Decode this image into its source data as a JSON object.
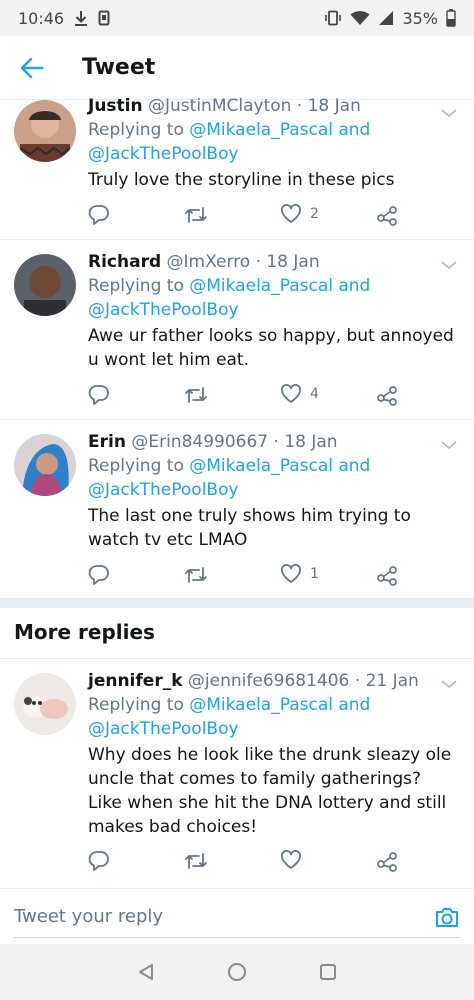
{
  "status_bar": {
    "time": "10:46",
    "battery": "35%"
  },
  "header": {
    "title": "Tweet"
  },
  "tweets": [
    {
      "name": "Justin",
      "handle": "@JustinMClayton",
      "date": "· 18 Jan",
      "replying_prefix": "Replying to",
      "replying_to_1": "@Mikaela_Pascal",
      "replying_and": "and",
      "replying_to_2": "@JackThePoolBoy",
      "text": "Truly love the storyline in these pics",
      "likes": "2"
    },
    {
      "name": "Richard",
      "handle": "@ImXerro",
      "date": "· 18 Jan",
      "replying_prefix": "Replying to",
      "replying_to_1": "@Mikaela_Pascal",
      "replying_and": "and",
      "replying_to_2": "@JackThePoolBoy",
      "text": "Awe ur father looks so happy, but annoyed u wont let him eat.",
      "likes": "4"
    },
    {
      "name": "Erin",
      "handle": "@Erin84990667",
      "date": "· 18 Jan",
      "replying_prefix": "Replying to",
      "replying_to_1": "@Mikaela_Pascal",
      "replying_and": "and",
      "replying_to_2": "@JackThePoolBoy",
      "text": "The last one truly shows him trying to watch tv etc LMAO",
      "likes": "1"
    }
  ],
  "more_replies": {
    "title": "More replies",
    "tweets": [
      {
        "name": "jennifer_k",
        "handle": "@jennife69681406",
        "date": "· 21 Jan",
        "replying_prefix": "Replying to",
        "replying_to_1": "@Mikaela_Pascal",
        "replying_and": "and",
        "replying_to_2": "@JackThePoolBoy",
        "text": "Why does he look like the drunk sleazy ole uncle that comes to family gatherings? Like when she hit the DNA lottery and still makes bad choices!",
        "likes": ""
      }
    ]
  },
  "reply_bar": {
    "placeholder": "Tweet your reply"
  },
  "colors": {
    "accent": "#1da1f2",
    "secondary_text": "#657786",
    "divider": "#e6ecf0"
  },
  "icons": {
    "reply": "reply-icon",
    "retweet": "retweet-icon",
    "like": "heart-icon",
    "share": "share-icon",
    "camera": "camera-icon"
  }
}
